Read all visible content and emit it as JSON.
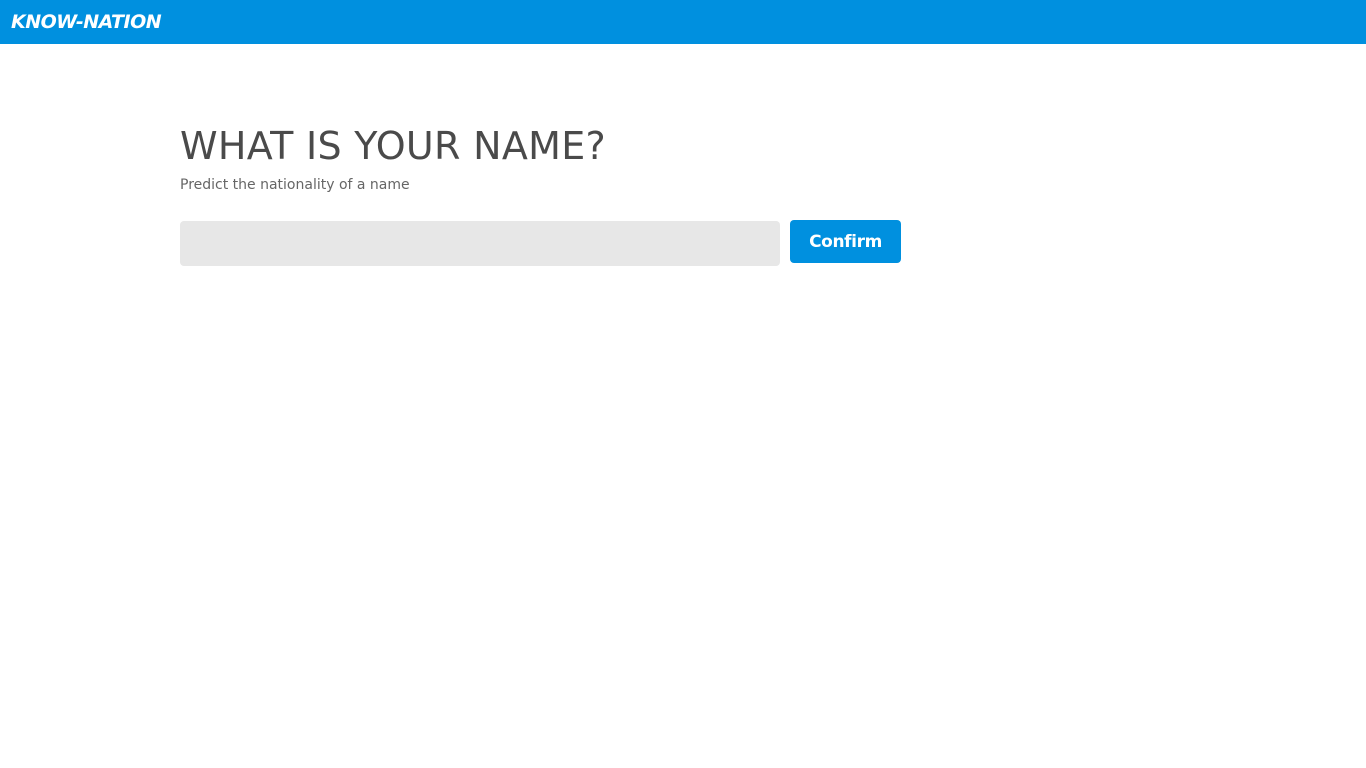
{
  "header": {
    "brand": "KNOW-NATION",
    "background_color": "#0090df"
  },
  "main": {
    "title": "WHAT IS YOUR NAME?",
    "subtitle": "Predict the nationality of a name",
    "name_input": {
      "value": "",
      "placeholder": ""
    },
    "confirm_label": "Confirm",
    "accent_color": "#0090df"
  }
}
